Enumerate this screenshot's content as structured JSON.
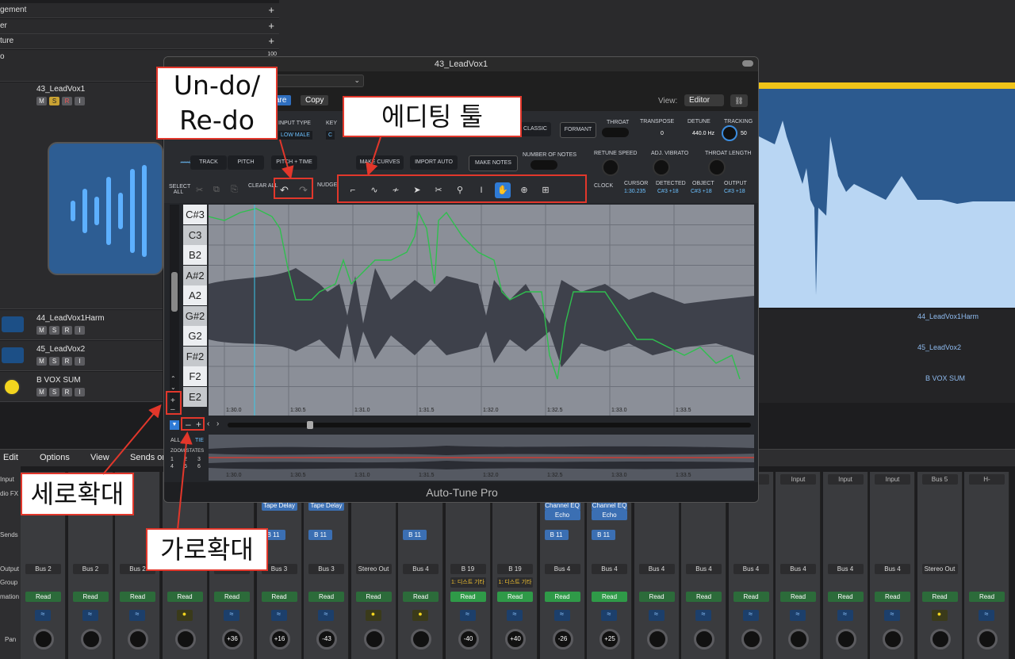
{
  "global_tracks": [
    "gement",
    "er",
    "ture",
    "o"
  ],
  "scale_100": "100",
  "tracks": [
    {
      "name": "43_LeadVox1"
    },
    {
      "name": "44_LeadVox1Harm"
    },
    {
      "name": "45_LeadVox2"
    },
    {
      "name": "B VOX SUM"
    }
  ],
  "track_buttons": {
    "m": "M",
    "s": "S",
    "r": "R",
    "i": "I"
  },
  "lane_labels": [
    "44_LeadVox1Harm",
    "45_LeadVox2",
    "B VOX SUM"
  ],
  "mixer_menu": {
    "edit": "Edit",
    "options": "Options",
    "view": "View",
    "sends_on": "Sends on"
  },
  "mixer_row_labels": [
    "Input",
    "dio FX",
    "Sends",
    "Output",
    "Group",
    "mation",
    "Pan"
  ],
  "plugin": {
    "title": "43_LeadVox1",
    "footer": "Auto-Tune Pro",
    "view_label": "View:",
    "view_value": "Editor",
    "copy": "Copy",
    "compare": "are",
    "input_type_label": "INPUT TYPE",
    "input_type": "LOW MALE",
    "key_label": "KEY",
    "key": "C",
    "classic": "CLASSIC",
    "formant": "FORMANT",
    "throat": "THROAT",
    "transpose_label": "TRANSPOSE",
    "transpose": "0",
    "detune_label": "DETUNE",
    "detune": "440.0 Hz",
    "tracking_label": "TRACKING",
    "tracking": "50",
    "track": "TRACK",
    "pitch": "PITCH",
    "pitch_time": "PITCH + TIME",
    "make_curves": "MAKE CURVES",
    "import_auto": "IMPORT AUTO",
    "make_notes": "MAKE NOTES",
    "num_notes": "NUMBER OF NOTES",
    "retune_speed": "RETUNE SPEED",
    "adj_vibrato": "ADJ. VIBRATO",
    "throat_length": "THROAT LENGTH",
    "select_all": "SELECT ALL",
    "clear_all": "CLEAR ALL",
    "nudge": "NUDGE",
    "clock": "CLOCK",
    "cursor_label": "CURSOR",
    "cursor": "1:30.235",
    "detected_label": "DETECTED",
    "detected": "C#3 +18",
    "object_label": "OBJECT",
    "object": "C#3 +18",
    "output_label": "OUTPUT",
    "output": "C#3 +18",
    "notes": [
      "C#3",
      "C3",
      "B2",
      "A#2",
      "A2",
      "G#2",
      "G2",
      "F#2",
      "F2",
      "E2"
    ],
    "time_marks": [
      "1:30.0",
      "1:30.5",
      "1:31.0",
      "1:31.5",
      "1:32.0",
      "1:32.5",
      "1:33.0",
      "1:33.5"
    ],
    "all": "ALL",
    "tie": "TIE",
    "zoom_states": "ZOOM STATES",
    "zoom_nums": [
      "1",
      "2",
      "3",
      "4",
      "5",
      "6"
    ]
  },
  "callouts": {
    "undo": "Un-do/\nRe-do",
    "editing": "에디팅 툴",
    "vertical": "세로확대",
    "horizontal": "가로확대"
  },
  "mixer": {
    "outputs": [
      "Bus 2",
      "Bus 2",
      "Bus 2",
      "",
      "3",
      "Bus 3",
      "Bus 3",
      "Stereo Out",
      "Bus 4",
      "B 19",
      "B 19",
      "Bus 4",
      "Bus 4",
      "Bus 4",
      "Bus 4",
      "Bus 4",
      "Bus 4",
      "Bus 4",
      "Bus 4",
      "Stereo Out",
      ""
    ],
    "pans": [
      "",
      "",
      "",
      "",
      "+36",
      "+16",
      "-43",
      "",
      "",
      "-40",
      "+40",
      "-26",
      "+25",
      "",
      "",
      "",
      "",
      "",
      "",
      "",
      ""
    ],
    "sends": [
      "",
      "",
      "",
      "",
      "",
      "B 11",
      "B 11",
      "",
      "B 11",
      "",
      "",
      "B 11",
      "B 11",
      "",
      "",
      "",
      "",
      "",
      "",
      "",
      ""
    ],
    "fx1": [
      "",
      "",
      "",
      "",
      "",
      "Tape Delay",
      "Tape Delay",
      "",
      "",
      "",
      "",
      "Channel EQ",
      "Channel EQ",
      "",
      "",
      "",
      "",
      "",
      "",
      "",
      ""
    ],
    "fx2": [
      "",
      "",
      "",
      "",
      "",
      "",
      "",
      "",
      "",
      "",
      "",
      "Echo",
      "Echo",
      "",
      "",
      "",
      "",
      "",
      "",
      "",
      ""
    ],
    "groups": [
      "",
      "",
      "",
      "",
      "",
      "",
      "",
      "",
      "",
      "1: 디스트 기타",
      "1: 디스트 기타",
      "",
      "",
      "",
      "",
      "",
      "",
      "",
      "",
      "",
      ""
    ],
    "inputs": [
      "",
      "",
      "",
      "",
      "",
      "",
      "",
      "",
      "",
      "",
      "",
      "",
      "",
      "",
      "",
      "Input",
      "Input",
      "Input",
      "Input",
      "Bus 5",
      "H-"
    ],
    "read": "Read"
  }
}
